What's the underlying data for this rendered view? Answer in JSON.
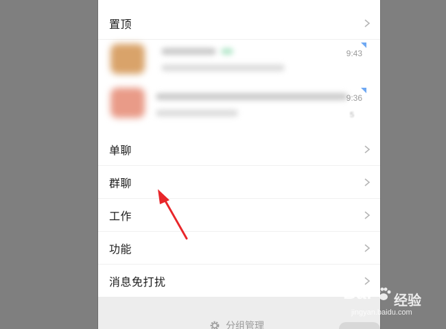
{
  "menu": {
    "pinned_label": "置顶",
    "items": [
      {
        "label": "单聊"
      },
      {
        "label": "群聊"
      },
      {
        "label": "工作"
      },
      {
        "label": "功能"
      },
      {
        "label": "消息免打扰"
      }
    ]
  },
  "preview": [
    {
      "time": "9:43"
    },
    {
      "time": "9:36",
      "snippet": "5"
    }
  ],
  "footer": {
    "group_manage_label": "分组管理",
    "icon": "gear-icon"
  },
  "annotation": {
    "color": "#e8262a"
  },
  "watermark": {
    "brand": "Bai",
    "cn": "经验",
    "url": "jingyan.baidu.com"
  }
}
